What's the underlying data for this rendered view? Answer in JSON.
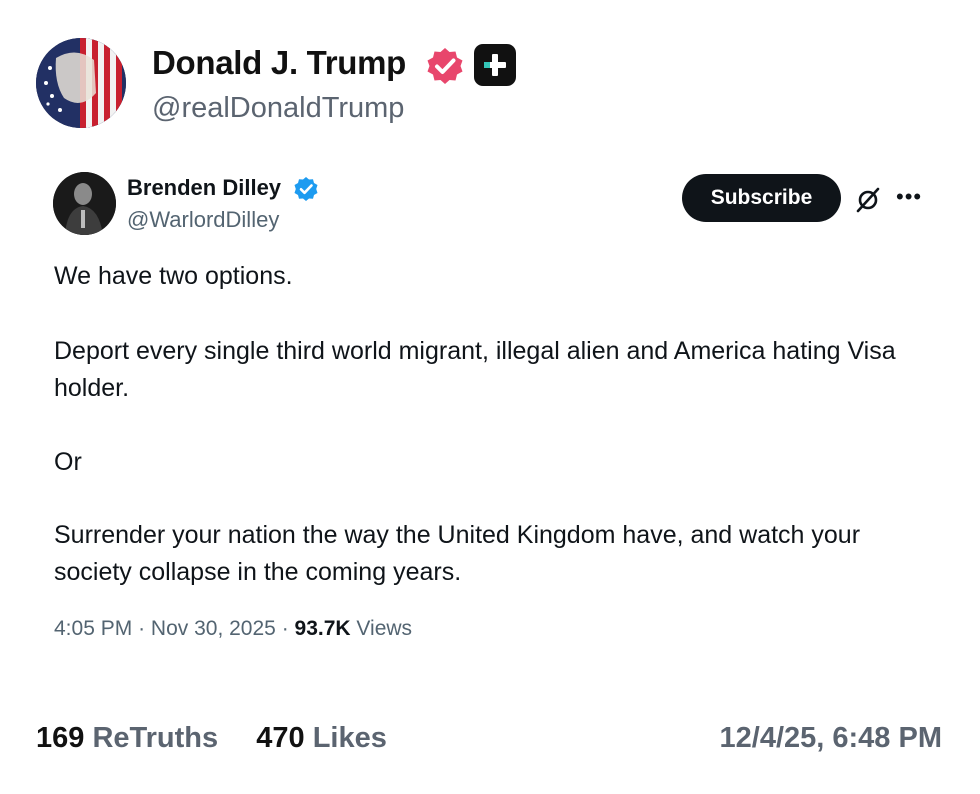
{
  "author": {
    "display_name": "Donald J. Trump",
    "handle": "@realDonaldTrump",
    "verified_badge_color": "#e8466c",
    "icons": [
      "avatar",
      "verified-badge-icon",
      "plus-badge-icon"
    ]
  },
  "embedded_post": {
    "display_name": "Brenden Dilley",
    "handle": "@WarlordDilley",
    "verified_badge_color": "#1d9bf0",
    "subscribe_label": "Subscribe",
    "paragraphs": [
      "We have two options.",
      "Deport every single third world migrant, illegal alien and America hating Visa holder.",
      "Or",
      "Surrender your nation the way the United Kingdom have, and watch your society collapse in the coming years."
    ],
    "time": "4:05 PM",
    "sep1": "·",
    "date": "Nov 30, 2025",
    "sep2": "·",
    "views_count": "93.7K",
    "views_label": "Views",
    "icons": [
      "grok-icon",
      "more-icon"
    ]
  },
  "footer": {
    "retruths_count": "169",
    "retruths_label": "ReTruths",
    "likes_count": "470",
    "likes_label": "Likes",
    "timestamp": "12/4/25, 6:48 PM"
  }
}
